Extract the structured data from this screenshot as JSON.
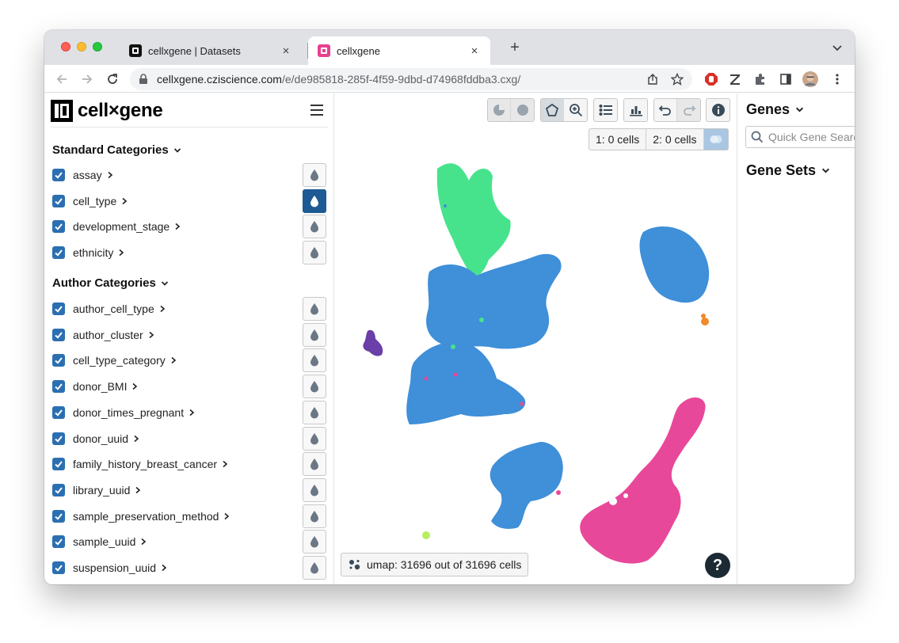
{
  "browser": {
    "tabs": [
      {
        "title": "cellxgene | Datasets",
        "active": false
      },
      {
        "title": "cellxgene",
        "active": true
      }
    ],
    "close_glyph": "×",
    "newtab_glyph": "+",
    "url_host": "cellxgene.cziscience.com",
    "url_path": "/e/de985818-285f-4f59-9dbd-d74968fddba3.cxg/"
  },
  "app": {
    "logo_text": "cell×gene",
    "standard_categories": {
      "title": "Standard Categories",
      "items": [
        {
          "label": "assay",
          "active": false
        },
        {
          "label": "cell_type",
          "active": true
        },
        {
          "label": "development_stage",
          "active": false
        },
        {
          "label": "ethnicity",
          "active": false
        }
      ]
    },
    "author_categories": {
      "title": "Author Categories",
      "items": [
        {
          "label": "author_cell_type"
        },
        {
          "label": "author_cluster"
        },
        {
          "label": "cell_type_category"
        },
        {
          "label": "donor_BMI"
        },
        {
          "label": "donor_times_pregnant"
        },
        {
          "label": "donor_uuid"
        },
        {
          "label": "family_history_breast_cancer"
        },
        {
          "label": "library_uuid"
        },
        {
          "label": "sample_preservation_method"
        },
        {
          "label": "sample_uuid"
        },
        {
          "label": "suspension_uuid"
        }
      ]
    },
    "cell_count_1": "1: 0 cells",
    "cell_count_2": "2: 0 cells",
    "embedding_label": "umap: 31696 out of 31696 cells",
    "help_glyph": "?",
    "genes_title": "Genes",
    "gene_search_placeholder": "Quick Gene Search",
    "gene_sets_title": "Gene Sets",
    "colors": {
      "blue_cluster": "#3f8fd9",
      "green_cluster": "#47e38c",
      "pink_cluster": "#e8489a",
      "purple_cluster": "#6a3fa8",
      "orange_cluster": "#f08a2e",
      "lime_cluster": "#b6ee5c",
      "active_button": "#1e5a94",
      "checkbox": "#2b6fb1"
    }
  }
}
